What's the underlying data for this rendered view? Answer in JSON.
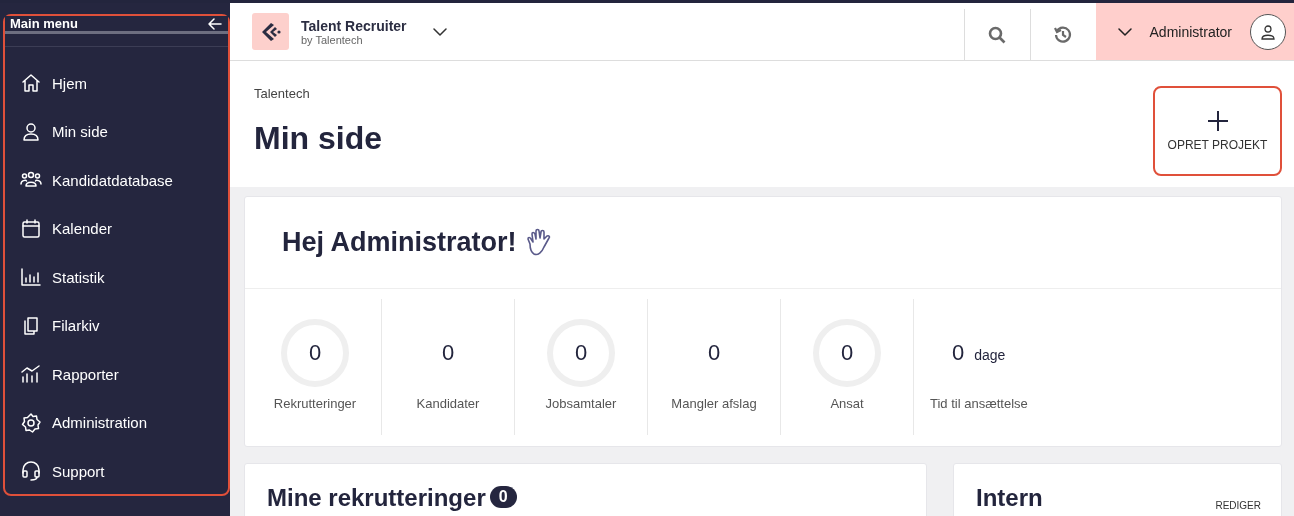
{
  "sidebar": {
    "title": "Main menu",
    "highlighted": true,
    "items": [
      {
        "label": "Hjem"
      },
      {
        "label": "Min side"
      },
      {
        "label": "Kandidatdatabase"
      },
      {
        "label": "Kalender"
      },
      {
        "label": "Statistik"
      },
      {
        "label": "Filarkiv"
      },
      {
        "label": "Rapporter"
      },
      {
        "label": "Administration"
      },
      {
        "label": "Support"
      }
    ]
  },
  "header": {
    "app_name": "Talent Recruiter",
    "app_subtitle": "by Talentech",
    "user": "Administrator"
  },
  "page": {
    "breadcrumb": "Talentech",
    "title": "Min side",
    "create_button": {
      "label": "OPRET PROJEKT",
      "highlighted": true
    }
  },
  "greeting": "Hej Administrator!",
  "stats": [
    {
      "kind": "ring",
      "value": "0",
      "label": "Rekrutteringer"
    },
    {
      "kind": "plain",
      "value": "0",
      "label": "Kandidater"
    },
    {
      "kind": "ring",
      "value": "0",
      "label": "Jobsamtaler"
    },
    {
      "kind": "plain",
      "value": "0",
      "label": "Mangler afslag"
    },
    {
      "kind": "ring",
      "value": "0",
      "label": "Ansat"
    },
    {
      "kind": "unit",
      "value": "0",
      "unit": "dage",
      "label": "Tid til ansættelse"
    }
  ],
  "recruitments": {
    "title": "Mine rekrutteringer",
    "count": "0"
  },
  "intern": {
    "title": "Intern",
    "action": "REDIGER"
  }
}
